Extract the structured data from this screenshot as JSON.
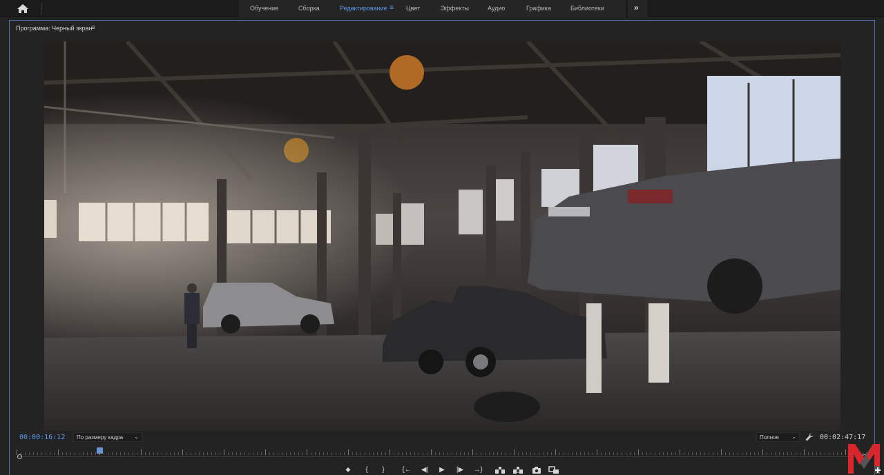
{
  "workspaces": {
    "tabs": [
      {
        "label": "Обучение"
      },
      {
        "label": "Сборка"
      },
      {
        "label": "Редактирование",
        "active": true
      },
      {
        "label": "Цвет"
      },
      {
        "label": "Эффекты"
      },
      {
        "label": "Аудио"
      },
      {
        "label": "Графика"
      },
      {
        "label": "Библиотеки"
      }
    ],
    "menu_glyph": "≡",
    "overflow_glyph": "»"
  },
  "program_monitor": {
    "title": "Программа: Черный экран",
    "menu_glyph": "≡",
    "current_timecode": "00:00:16:12",
    "fit_option": "По размеру кадра",
    "quality_option": "Полное",
    "duration_timecode": "00:02:47:17",
    "playhead_fraction": 0.098
  },
  "transport": {
    "marker_glyph": "⬥",
    "mark_in_glyph": "{",
    "mark_out_glyph": "}",
    "go_to_in_glyph": "{←",
    "step_back_glyph": "◀|",
    "play_glyph": "▶",
    "step_forward_glyph": "|▶",
    "go_to_out_glyph": "→}",
    "lift_icon": "lift-icon",
    "extract_icon": "extract-icon",
    "export_frame_icon": "camera-icon",
    "compare_icon": "comparison-view-icon"
  },
  "colors": {
    "accent": "#5b9be6",
    "panel_border": "#4a6fa5",
    "background": "#232323",
    "logo_red": "#d9262c",
    "logo_dark": "#555555"
  }
}
